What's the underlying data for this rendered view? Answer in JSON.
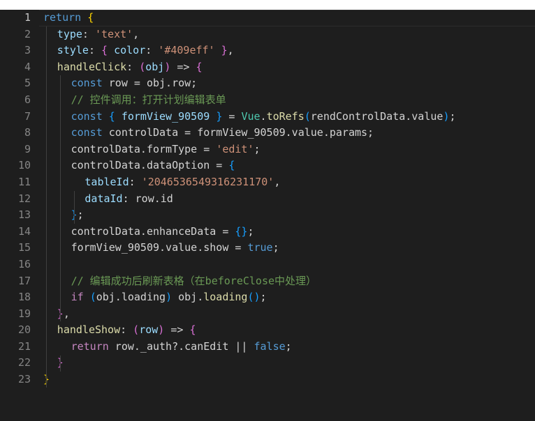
{
  "editor": {
    "active_line": 1,
    "lines": [
      {
        "n": "1",
        "indent": 0,
        "tokens": [
          {
            "t": "return",
            "c": "kw"
          },
          {
            "t": " ",
            "c": "pl"
          },
          {
            "t": "{",
            "c": "b1"
          }
        ]
      },
      {
        "n": "2",
        "indent": 1,
        "tokens": [
          {
            "t": "type",
            "c": "prop"
          },
          {
            "t": ": ",
            "c": "pl"
          },
          {
            "t": "'text'",
            "c": "str"
          },
          {
            "t": ",",
            "c": "pl"
          }
        ]
      },
      {
        "n": "3",
        "indent": 1,
        "tokens": [
          {
            "t": "style",
            "c": "prop"
          },
          {
            "t": ": ",
            "c": "pl"
          },
          {
            "t": "{",
            "c": "b2"
          },
          {
            "t": " ",
            "c": "pl"
          },
          {
            "t": "color",
            "c": "prop"
          },
          {
            "t": ": ",
            "c": "pl"
          },
          {
            "t": "'#409eff'",
            "c": "str"
          },
          {
            "t": " ",
            "c": "pl"
          },
          {
            "t": "}",
            "c": "b2"
          },
          {
            "t": ",",
            "c": "pl"
          }
        ]
      },
      {
        "n": "4",
        "indent": 1,
        "tokens": [
          {
            "t": "handleClick",
            "c": "fn"
          },
          {
            "t": ": ",
            "c": "pl"
          },
          {
            "t": "(",
            "c": "b2"
          },
          {
            "t": "obj",
            "c": "prop"
          },
          {
            "t": ")",
            "c": "b2"
          },
          {
            "t": " => ",
            "c": "pl"
          },
          {
            "t": "{",
            "c": "b2"
          }
        ]
      },
      {
        "n": "5",
        "indent": 2,
        "tokens": [
          {
            "t": "const",
            "c": "kw"
          },
          {
            "t": " row = obj.row;",
            "c": "pl"
          }
        ]
      },
      {
        "n": "6",
        "indent": 2,
        "tokens": [
          {
            "t": "// 控件调用：打开计划编辑表单",
            "c": "cm"
          }
        ]
      },
      {
        "n": "7",
        "indent": 2,
        "tokens": [
          {
            "t": "const",
            "c": "kw"
          },
          {
            "t": " ",
            "c": "pl"
          },
          {
            "t": "{",
            "c": "b3"
          },
          {
            "t": " formView_90509 ",
            "c": "prop"
          },
          {
            "t": "}",
            "c": "b3"
          },
          {
            "t": " = ",
            "c": "pl"
          },
          {
            "t": "Vue",
            "c": "cls"
          },
          {
            "t": ".",
            "c": "pl"
          },
          {
            "t": "toRefs",
            "c": "fn"
          },
          {
            "t": "(",
            "c": "b3"
          },
          {
            "t": "rendControlData.value",
            "c": "pl"
          },
          {
            "t": ")",
            "c": "b3"
          },
          {
            "t": ";",
            "c": "pl"
          }
        ]
      },
      {
        "n": "8",
        "indent": 2,
        "tokens": [
          {
            "t": "const",
            "c": "kw"
          },
          {
            "t": " controlData = formView_90509.value.params;",
            "c": "pl"
          }
        ]
      },
      {
        "n": "9",
        "indent": 2,
        "tokens": [
          {
            "t": "controlData.formType = ",
            "c": "pl"
          },
          {
            "t": "'edit'",
            "c": "str"
          },
          {
            "t": ";",
            "c": "pl"
          }
        ]
      },
      {
        "n": "10",
        "indent": 2,
        "tokens": [
          {
            "t": "controlData.dataOption = ",
            "c": "pl"
          },
          {
            "t": "{",
            "c": "b3"
          }
        ]
      },
      {
        "n": "11",
        "indent": 3,
        "tokens": [
          {
            "t": "tableId",
            "c": "prop"
          },
          {
            "t": ": ",
            "c": "pl"
          },
          {
            "t": "'2046536549316231170'",
            "c": "str"
          },
          {
            "t": ",",
            "c": "pl"
          }
        ]
      },
      {
        "n": "12",
        "indent": 3,
        "tokens": [
          {
            "t": "dataId",
            "c": "prop"
          },
          {
            "t": ": row.id",
            "c": "pl"
          }
        ]
      },
      {
        "n": "13",
        "indent": 2,
        "tokens": [
          {
            "t": "}",
            "c": "b3"
          },
          {
            "t": ";",
            "c": "pl"
          }
        ]
      },
      {
        "n": "14",
        "indent": 2,
        "tokens": [
          {
            "t": "controlData.enhanceData = ",
            "c": "pl"
          },
          {
            "t": "{}",
            "c": "b3"
          },
          {
            "t": ";",
            "c": "pl"
          }
        ]
      },
      {
        "n": "15",
        "indent": 2,
        "tokens": [
          {
            "t": "formView_90509.value.show = ",
            "c": "pl"
          },
          {
            "t": "true",
            "c": "kw"
          },
          {
            "t": ";",
            "c": "pl"
          }
        ]
      },
      {
        "n": "16",
        "indent": 2,
        "tokens": []
      },
      {
        "n": "17",
        "indent": 2,
        "tokens": [
          {
            "t": "// 编辑成功后刷新表格（在beforeClose中处理）",
            "c": "cm"
          }
        ]
      },
      {
        "n": "18",
        "indent": 2,
        "tokens": [
          {
            "t": "if",
            "c": "ctl"
          },
          {
            "t": " ",
            "c": "pl"
          },
          {
            "t": "(",
            "c": "b3"
          },
          {
            "t": "obj.loading",
            "c": "pl"
          },
          {
            "t": ")",
            "c": "b3"
          },
          {
            "t": " obj.",
            "c": "pl"
          },
          {
            "t": "loading",
            "c": "fn"
          },
          {
            "t": "()",
            "c": "b3"
          },
          {
            "t": ";",
            "c": "pl"
          }
        ]
      },
      {
        "n": "19",
        "indent": 1,
        "tokens": [
          {
            "t": "}",
            "c": "b2"
          },
          {
            "t": ",",
            "c": "pl"
          }
        ]
      },
      {
        "n": "20",
        "indent": 1,
        "tokens": [
          {
            "t": "handleShow",
            "c": "fn"
          },
          {
            "t": ": ",
            "c": "pl"
          },
          {
            "t": "(",
            "c": "b2"
          },
          {
            "t": "row",
            "c": "prop"
          },
          {
            "t": ")",
            "c": "b2"
          },
          {
            "t": " => ",
            "c": "pl"
          },
          {
            "t": "{",
            "c": "b2"
          }
        ]
      },
      {
        "n": "21",
        "indent": 2,
        "tokens": [
          {
            "t": "return",
            "c": "ctl"
          },
          {
            "t": " row._auth?.canEdit || ",
            "c": "pl"
          },
          {
            "t": "false",
            "c": "kw"
          },
          {
            "t": ";",
            "c": "pl"
          }
        ]
      },
      {
        "n": "22",
        "indent": 1,
        "tokens": [
          {
            "t": "}",
            "c": "b2"
          }
        ]
      },
      {
        "n": "23",
        "indent": 0,
        "tokens": [
          {
            "t": "}",
            "c": "b1"
          }
        ]
      }
    ]
  },
  "colors": {
    "background": "#1e1e1e",
    "keyword": "#569cd6",
    "control": "#c586c0",
    "property": "#9cdcfe",
    "string": "#ce9178",
    "function": "#dcdcaa",
    "class": "#4ec9b0",
    "comment": "#6a9955",
    "bracket_1": "#ffd700",
    "bracket_2": "#da70d6",
    "bracket_3": "#179fff"
  }
}
